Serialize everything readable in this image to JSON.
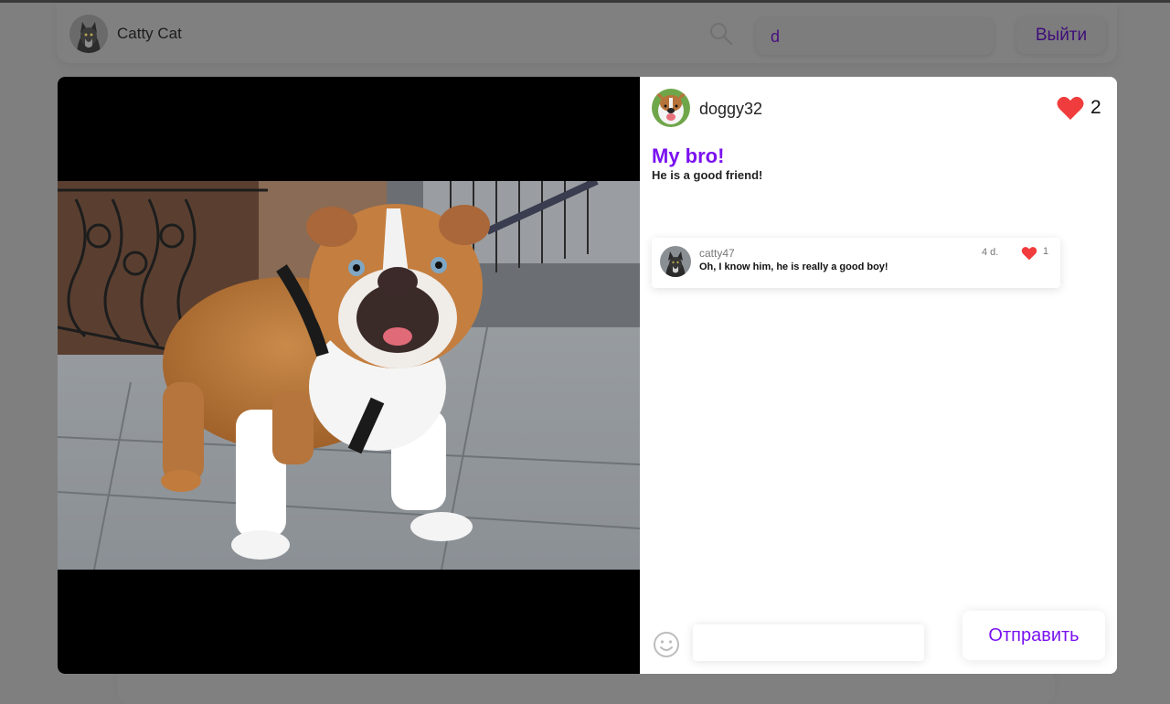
{
  "header": {
    "username": "Catty Cat",
    "search_value": "d",
    "logout_label": "Выйти"
  },
  "post": {
    "author": "doggy32",
    "likes": "2",
    "title": "My bro!",
    "text": "He is a good friend!",
    "like_color": "#f03c3c",
    "accent_color": "#7a12f0"
  },
  "comments": [
    {
      "author": "catty47",
      "text": "Oh, I know him, he is really a good boy!",
      "time": "4 d.",
      "likes": "1"
    }
  ],
  "composer": {
    "input_value": "",
    "send_label": "Отправить",
    "emoji_icon": "smiley-icon"
  }
}
